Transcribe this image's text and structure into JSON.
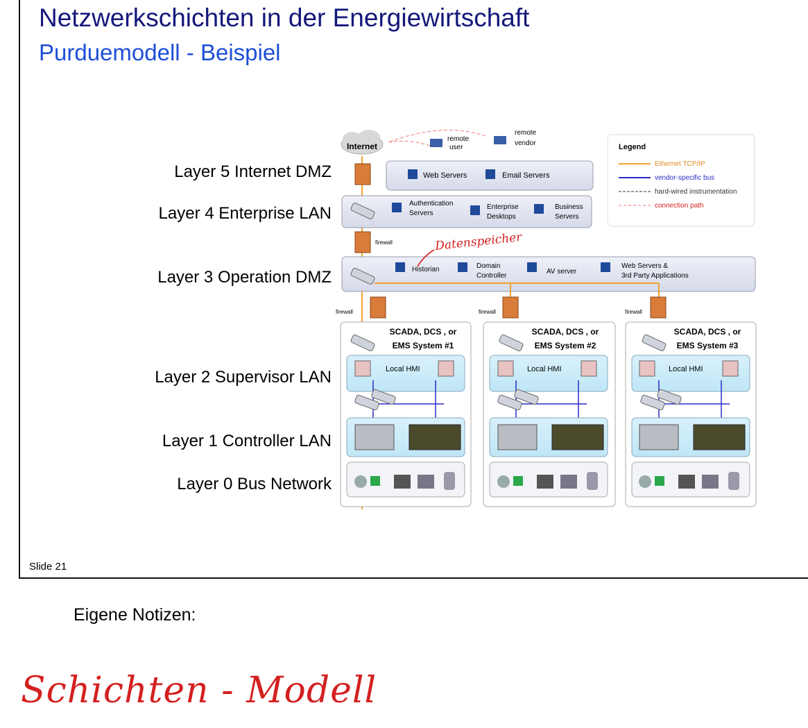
{
  "slide": {
    "title": "Netzwerkschichten in der Energiewirtschaft",
    "subtitle": "Purduemodell - Beispiel",
    "slide_number": "Slide 21"
  },
  "layers": [
    {
      "label": "Layer 5 Internet DMZ"
    },
    {
      "label": "Layer 4 Enterprise LAN"
    },
    {
      "label": "Layer 3 Operation DMZ"
    },
    {
      "label": "Layer 2 Supervisor LAN"
    },
    {
      "label": "Layer 1 Controller LAN"
    },
    {
      "label": "Layer 0 Bus Network"
    }
  ],
  "diagram": {
    "internet": "Internet",
    "remote_user": [
      "remote",
      "user"
    ],
    "remote_vendor": [
      "remote",
      "vendor"
    ],
    "web_servers": "Web Servers",
    "email_servers": "Email Servers",
    "auth_servers": [
      "Authentication",
      "Servers"
    ],
    "enterprise_desktops": [
      "Enterprise",
      "Desktops"
    ],
    "business_servers": [
      "Business",
      "Servers"
    ],
    "firewall": "firewall",
    "historian": "Historian",
    "domain_controller": [
      "Domain",
      "Controller"
    ],
    "av_server": "AV server",
    "web_servers_3rd": [
      "Web Servers &",
      "3rd Party Applications"
    ],
    "systems": [
      {
        "line1": "SCADA, DCS , or",
        "line2": "EMS System #1"
      },
      {
        "line1": "SCADA, DCS , or",
        "line2": "EMS System #2"
      },
      {
        "line1": "SCADA, DCS , or",
        "line2": "EMS System #3"
      }
    ],
    "local_hmi": "Local HMI",
    "annotation": "Datenspeicher",
    "legend": {
      "title": "Legend",
      "items": [
        "Ethernet TCP/IP",
        "vendor-specific bus",
        "hard-wired instrumentation",
        "connection path"
      ]
    }
  },
  "notes": {
    "heading": "Eigene Notizen:",
    "handwriting": "Schichten - Modell"
  },
  "colors": {
    "title": "#14187a",
    "subtitle": "#1d4fd6",
    "ethernet": "#f0a030",
    "bus": "#2a2ac8",
    "handwriting": "#d42020"
  }
}
